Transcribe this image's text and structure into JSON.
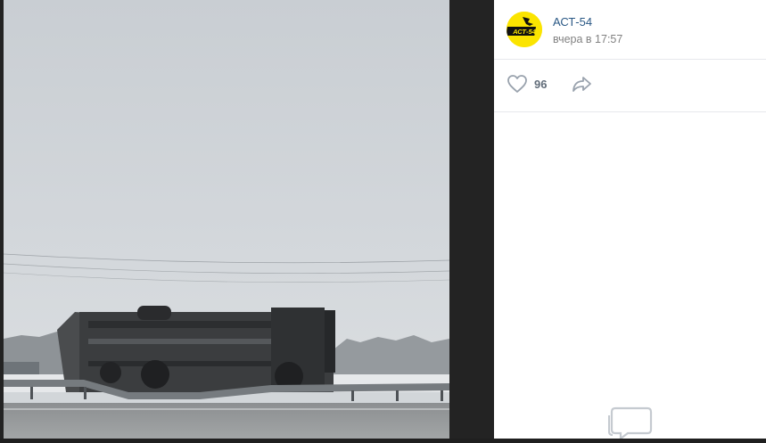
{
  "post": {
    "author_name": "АСТ-54",
    "time": "вчера в 17:57",
    "avatar_text": "АСТ-54",
    "likes": "96"
  },
  "icons": {
    "like": "heart-icon",
    "share": "share-arrow-icon",
    "comments": "comment-bubble-icon"
  },
  "colors": {
    "avatar_bg": "#fbe400",
    "link": "#2a5885",
    "muted": "#828282",
    "viewer_bg": "#1f1f1f"
  }
}
